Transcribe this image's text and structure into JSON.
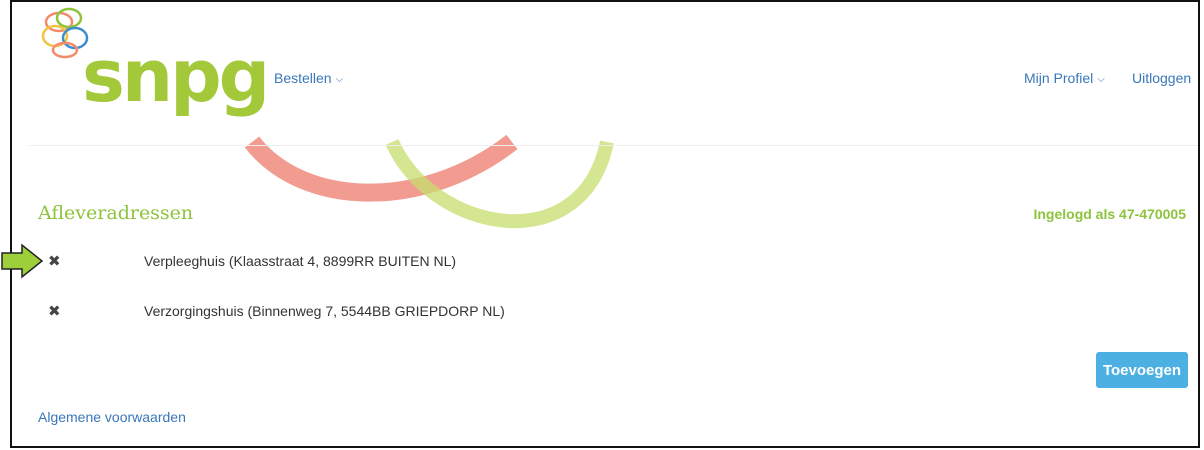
{
  "brand": {
    "logo_text": "snpg"
  },
  "nav": {
    "order_label": "Bestellen",
    "profile_label": "Mijn Profiel",
    "logout_label": "Uitloggen"
  },
  "page": {
    "title": "Afleveradressen",
    "logged_in_text": "Ingelogd als 47-470005"
  },
  "addresses": [
    {
      "label": "Verpleeghuis (Klaasstraat 4, 8899RR BUITEN NL)"
    },
    {
      "label": "Verzorgingshuis (Binnenweg 7, 5544BB GRIEPDORP NL)"
    }
  ],
  "actions": {
    "add_label": "Toevoegen"
  },
  "footer": {
    "terms_label": "Algemene voorwaarden"
  },
  "icons": {
    "remove": "close-icon",
    "chevron": "chevron-down-icon",
    "annotation": "arrow-right-icon"
  },
  "colors": {
    "brand_green": "#a3c93a",
    "link_blue": "#3a77b8",
    "button_blue": "#4cb0e3",
    "swirl_red": "#f0897c"
  }
}
